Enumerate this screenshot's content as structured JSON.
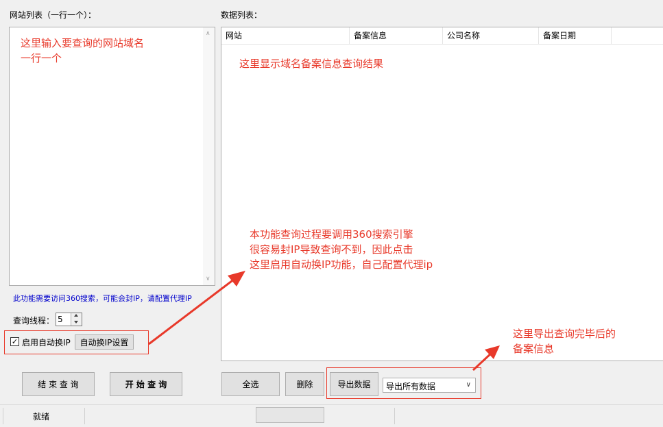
{
  "left": {
    "title": "网站列表（一行一个）：",
    "textarea_hint_line1": "这里输入要查询的网站域名",
    "textarea_hint_line2": "一行一个",
    "notice": "此功能需要访问360搜索，可能会封IP，请配置代理IP",
    "threads_label": "查询线程：",
    "threads_value": "5",
    "auto_ip_checkbox_label": "启用自动换IP",
    "auto_ip_checked": true,
    "auto_ip_settings_button": "自动换IP设置",
    "stop_button": "结 束 查 询",
    "start_button": "开 始 查 询"
  },
  "right": {
    "title": "数据列表：",
    "columns": [
      "网站",
      "备案信息",
      "公司名称",
      "备案日期"
    ],
    "list_hint": "这里显示域名备案信息查询结果",
    "select_all_button": "全选",
    "delete_button": "删除",
    "export_button": "导出数据",
    "export_select_value": "导出所有数据"
  },
  "annotations": {
    "proxy_line1": "本功能查询过程要调用360搜索引擎",
    "proxy_line2": "很容易封IP导致查询不到，因此点击",
    "proxy_line3": "这里启用自动换IP功能，自己配置代理ip",
    "export_line1": "这里导出查询完毕后的",
    "export_line2": "备案信息"
  },
  "status": {
    "text": "就绪"
  },
  "colors": {
    "annotation": "#e8392a",
    "notice": "#0000cc",
    "window_bg": "#f0f0f0"
  }
}
